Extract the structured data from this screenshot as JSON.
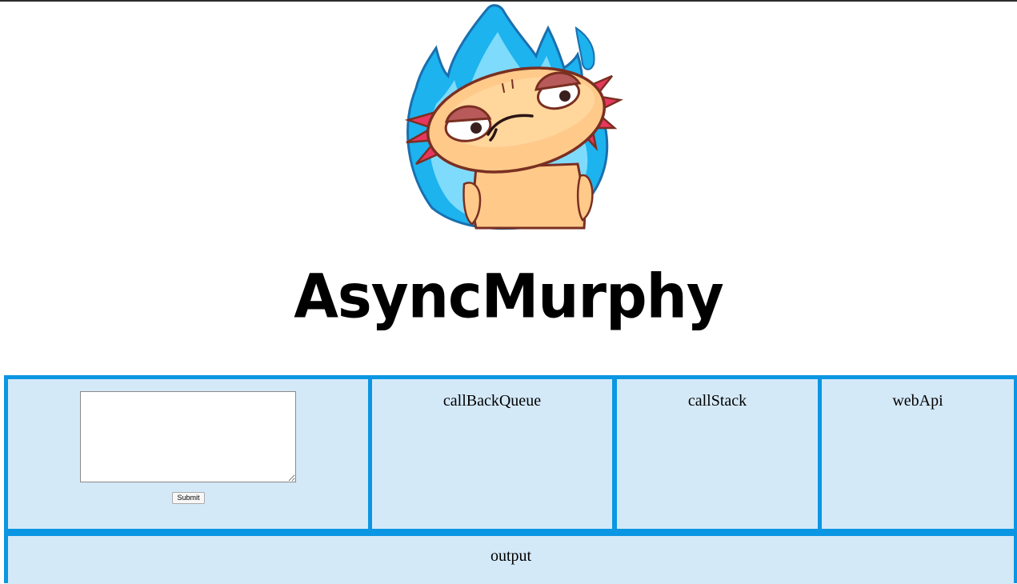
{
  "app": {
    "title": "AsyncMurphy"
  },
  "mascot": {
    "icon": "axolotl-mascot-icon",
    "colors": {
      "flame": "#1cb3ef",
      "flame_light": "#7fdbfb",
      "skin": "#ffc98a",
      "gills": "#e8375e",
      "outline": "#7a2f22"
    }
  },
  "colors": {
    "border": "#0b96e3",
    "panel_bg": "#d4e9f8"
  },
  "input_panel": {
    "code_value": "",
    "code_placeholder": "",
    "submit_label": "Submit"
  },
  "panels": {
    "callback_queue": "callBackQueue",
    "call_stack": "callStack",
    "web_api": "webApi",
    "output": "output"
  }
}
